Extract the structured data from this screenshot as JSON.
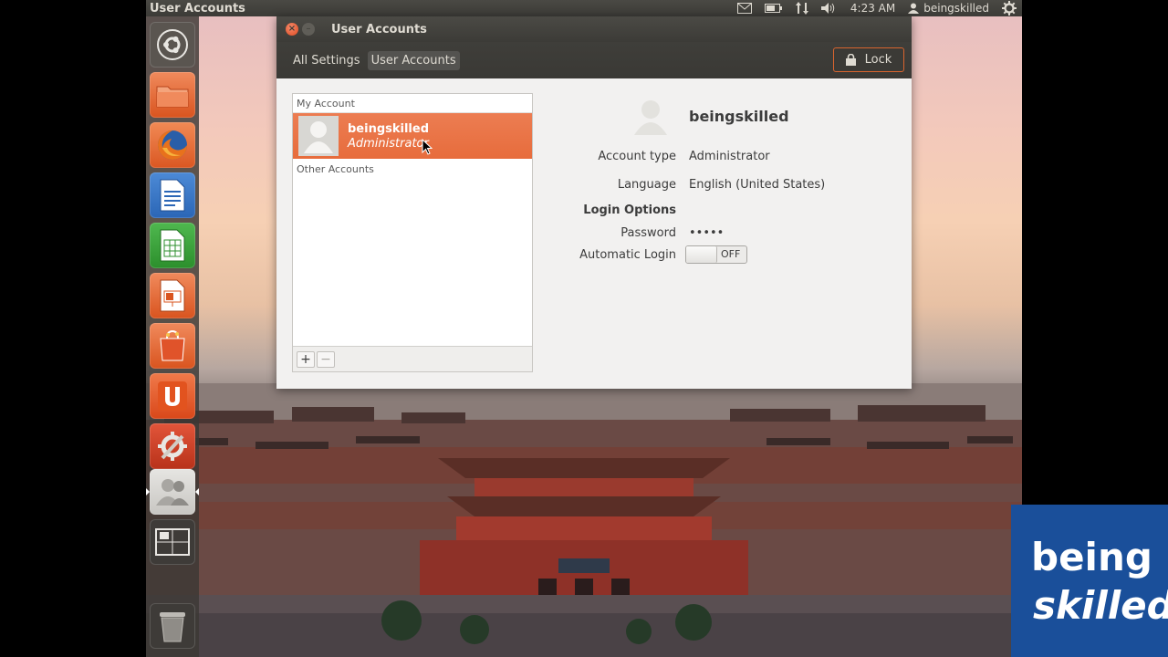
{
  "panel": {
    "app_title": "User Accounts",
    "time": "4:23 AM",
    "user": "beingskilled"
  },
  "launcher": {
    "items": [
      {
        "name": "ubuntu-dash-icon"
      },
      {
        "name": "home-folder-icon"
      },
      {
        "name": "firefox-icon"
      },
      {
        "name": "libreoffice-writer-icon"
      },
      {
        "name": "libreoffice-calc-icon"
      },
      {
        "name": "libreoffice-impress-icon"
      },
      {
        "name": "software-center-icon"
      },
      {
        "name": "ubuntu-one-icon"
      },
      {
        "name": "system-settings-icon"
      },
      {
        "name": "user-accounts-icon"
      },
      {
        "name": "workspace-switcher-icon"
      },
      {
        "name": "trash-icon"
      }
    ]
  },
  "window": {
    "title": "User Accounts",
    "breadcrumb": {
      "all_settings": "All Settings",
      "current": "User Accounts"
    },
    "lock_label": "Lock"
  },
  "accounts": {
    "my_account_header": "My Account",
    "selected": {
      "name": "beingskilled",
      "type": "Administrator"
    },
    "other_accounts_header": "Other Accounts",
    "add_label": "+",
    "remove_label": "−"
  },
  "details": {
    "name": "beingskilled",
    "account_type_label": "Account type",
    "account_type_value": "Administrator",
    "language_label": "Language",
    "language_value": "English (United States)",
    "login_options_label": "Login Options",
    "password_label": "Password",
    "password_value": "•••••",
    "automatic_login_label": "Automatic Login",
    "automatic_login_state": "OFF"
  },
  "brand": {
    "line1": "being",
    "line2": "skilled"
  },
  "colors": {
    "accent": "#e76c3c",
    "brand_blue": "#1a4f9a"
  }
}
